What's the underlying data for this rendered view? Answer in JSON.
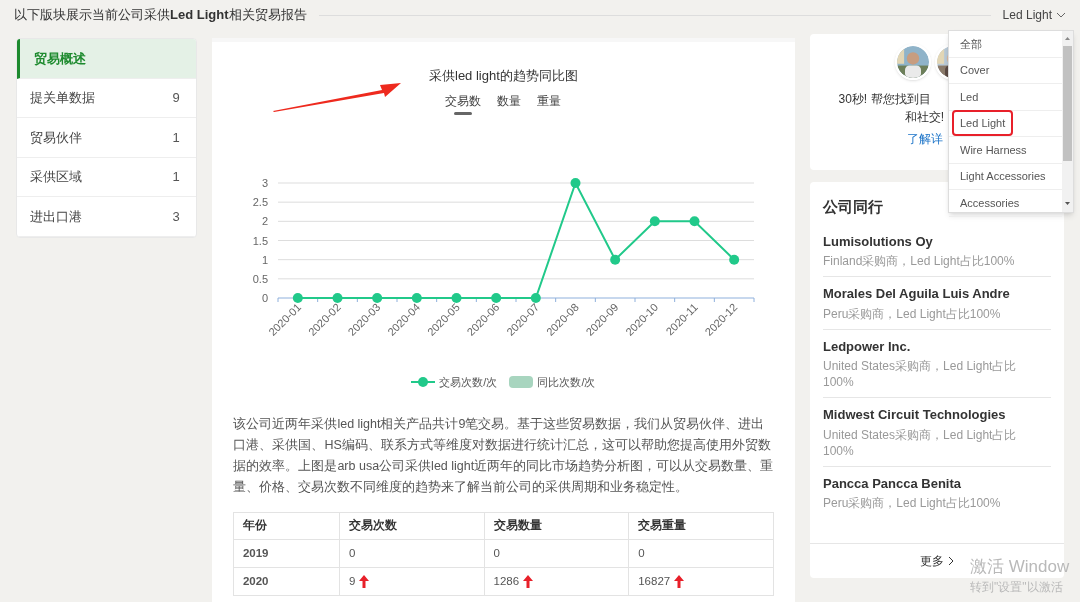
{
  "header": {
    "title": "以下版块展示当前公司采供**Led Light**相关贸易报告",
    "filter": "Led Light"
  },
  "dropdown": {
    "items": [
      {
        "label": "全部",
        "selected": false
      },
      {
        "label": "Cover",
        "selected": false
      },
      {
        "label": "Led",
        "selected": false
      },
      {
        "label": "Led Light",
        "selected": true
      },
      {
        "label": "Wire Harness",
        "selected": false
      },
      {
        "label": "Light Accessories",
        "selected": false
      },
      {
        "label": "Accessories",
        "selected": false
      }
    ]
  },
  "sidebar": {
    "items": [
      {
        "label": "贸易概述",
        "selected": true
      },
      {
        "label": "提关单数据",
        "count": "9",
        "selected": false
      },
      {
        "label": "贸易伙伴",
        "count": "1",
        "selected": false
      },
      {
        "label": "采供区域",
        "count": "1",
        "selected": false
      },
      {
        "label": "进出口港",
        "count": "3",
        "selected": false
      }
    ]
  },
  "chart": {
    "tabs": [
      {
        "label": "交易数",
        "selected": true
      },
      {
        "label": "数量",
        "selected": false
      },
      {
        "label": "重量",
        "selected": false
      }
    ],
    "chart_data": {
      "type": "line",
      "title": "采供led light的趋势同比图",
      "categories": [
        "2020-01",
        "2020-02",
        "2020-03",
        "2020-04",
        "2020-05",
        "2020-06",
        "2020-07",
        "2020-08",
        "2020-09",
        "2020-10",
        "2020-11",
        "2020-12"
      ],
      "grid": true,
      "series": [
        {
          "name": "交易次数/次",
          "color": "#21c98a",
          "marker": "circle",
          "values": [
            0,
            0,
            0,
            0,
            0,
            0,
            0,
            3,
            1,
            2,
            2,
            1
          ]
        },
        {
          "name": "同比次数/次",
          "color": "#a8d5bf",
          "values": [
            null,
            null,
            null,
            null,
            null,
            null,
            null,
            null,
            null,
            null,
            null,
            null
          ]
        }
      ],
      "ylim": [
        0,
        3
      ],
      "yticks": [
        0,
        0.5,
        1,
        1.5,
        2,
        2.5,
        3
      ]
    }
  },
  "summary": "该公司近两年采供led light相关产品共计9笔交易。基于这些贸易数据，我们从贸易伙伴、进出口港、采供国、HS编码、联系方式等维度对数据进行统计汇总，这可以帮助您提高使用外贸数据的效率。上图是arb usa公司采供led light近两年的同比市场趋势分析图，可以从交易数量、重量、价格、交易次数不同维度的趋势来了解当前公司的采供周期和业务稳定性。",
  "table": {
    "columns": [
      "年份",
      "交易次数",
      "交易数量",
      "交易重量"
    ],
    "rows": [
      {
        "cells": [
          {
            "text": "2019"
          },
          {
            "text": "0"
          },
          {
            "text": "0"
          },
          {
            "text": "0"
          }
        ]
      },
      {
        "cells": [
          {
            "text": "2020"
          },
          {
            "text": "9",
            "trend_up": true
          },
          {
            "text": "1286",
            "trend_up": true
          },
          {
            "text": "16827",
            "trend_up": true
          }
        ]
      }
    ]
  },
  "promo": {
    "line_1": "30秒! 帮您找到目",
    "line_2": "和社交!",
    "link": "了解详"
  },
  "peers": {
    "title": "公司同行",
    "items": [
      {
        "name": "Lumisolutions Oy",
        "detail": "Finland采购商，Led Light占比100%"
      },
      {
        "name": "Morales Del Aguila Luis Andre",
        "detail": "Peru采购商，Led Light占比100%"
      },
      {
        "name": "Ledpower Inc.",
        "detail": "United States采购商，Led Light占比100%"
      },
      {
        "name": "Midwest Circuit Technologies",
        "detail": "United States采购商，Led Light占比100%"
      },
      {
        "name": "Pancca Pancca Benita",
        "detail": "Peru采购商，Led Light占比100%"
      }
    ],
    "more": "更多"
  },
  "activation_notice": {
    "title": "激活 Window",
    "subtitle": "转到\"设置\"以激活"
  }
}
